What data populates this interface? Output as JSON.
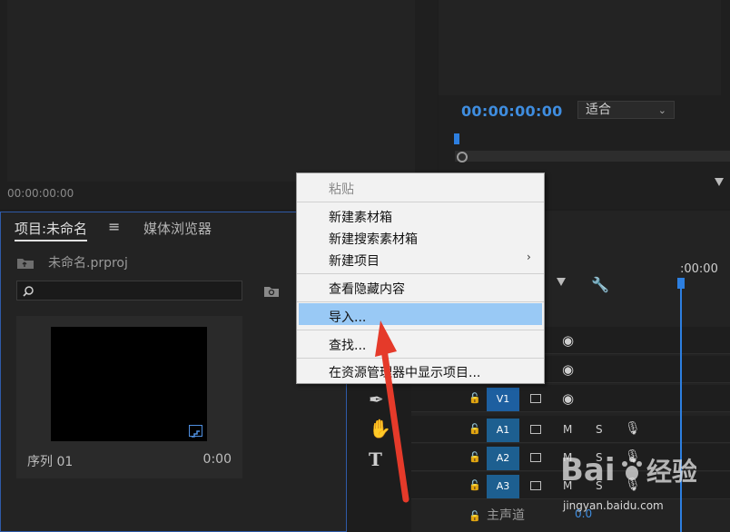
{
  "source_monitor": {
    "timecode": "00:00:00:00"
  },
  "program_monitor": {
    "timecode": "00:00:00:00",
    "fit_select": "适合"
  },
  "project_panel": {
    "tab_project": "项目:未命名",
    "tab_media": "媒体浏览器",
    "project_file": "未命名.prproj",
    "search_placeholder": "",
    "item": {
      "name": "序列 01",
      "duration": "0:00"
    }
  },
  "timeline": {
    "ruler_time": ":00:00",
    "tracks": [
      {
        "label": "V1",
        "type": "video"
      },
      {
        "label": "A1",
        "type": "audio",
        "m": "M",
        "s": "S"
      },
      {
        "label": "A2",
        "type": "audio",
        "m": "M",
        "s": "S"
      },
      {
        "label": "A3",
        "type": "audio",
        "m": "M",
        "s": "S"
      }
    ],
    "master": {
      "label": "主声道",
      "value": "0.0"
    }
  },
  "context_menu": {
    "items": [
      {
        "label": "粘贴",
        "disabled": true
      },
      {
        "label": "新建素材箱"
      },
      {
        "label": "新建搜索素材箱"
      },
      {
        "label": "新建项目"
      },
      {
        "label": "查看隐藏内容"
      },
      {
        "label": "导入..."
      },
      {
        "label": "查找..."
      },
      {
        "label": "在资源管理器中显示项目..."
      }
    ]
  },
  "watermark": {
    "text": "jingyan.baidu.com",
    "logo_text": "Bai经验"
  },
  "colors": {
    "accent_blue": "#3f8ddf",
    "highlight": "#99c9f5",
    "track_label": "#1d5fa0",
    "arrow_red": "#e53a2a"
  }
}
